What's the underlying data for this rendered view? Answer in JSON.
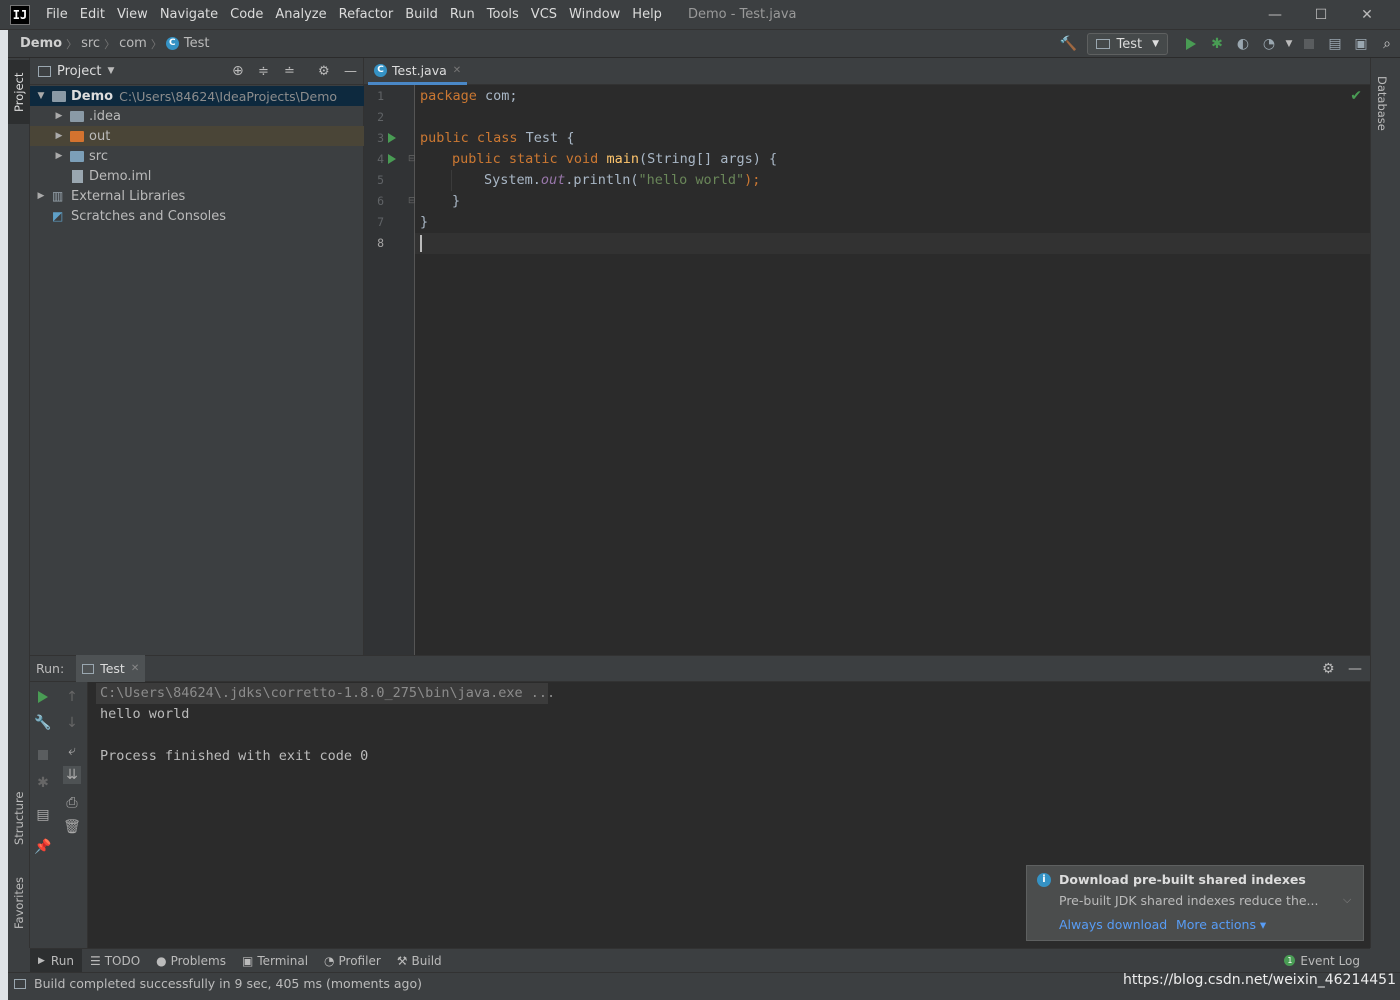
{
  "titlebar": {
    "logo": "IJ",
    "menu": [
      "File",
      "Edit",
      "View",
      "Navigate",
      "Code",
      "Analyze",
      "Refactor",
      "Build",
      "Run",
      "Tools",
      "VCS",
      "Window",
      "Help"
    ],
    "window_title": "Demo - Test.java",
    "controls": {
      "minimize": "—",
      "maximize": "☐",
      "close": "✕"
    }
  },
  "breadcrumb": {
    "project": "Demo",
    "items": [
      "src",
      "com",
      "Test"
    ]
  },
  "toolbar": {
    "run_config": "Test"
  },
  "left_stripe": {
    "project_tab": "Project",
    "structure_tab": "Structure",
    "favorites_tab": "Favorites"
  },
  "right_stripe": {
    "database_tab": "Database"
  },
  "project_panel": {
    "title": "Project",
    "tree": {
      "root_name": "Demo",
      "root_path": "C:\\Users\\84624\\IdeaProjects\\Demo",
      "idea": ".idea",
      "out": "out",
      "src": "src",
      "iml": "Demo.iml",
      "ext_libs": "External Libraries",
      "scratches": "Scratches and Consoles"
    }
  },
  "editor": {
    "tab_label": "Test.java",
    "line_numbers": [
      "1",
      "2",
      "3",
      "4",
      "5",
      "6",
      "7",
      "8"
    ],
    "code": {
      "l1_kw": "package",
      "l1_rest": " com;",
      "l3_kw": "public class",
      "l3_rest": " Test {",
      "l4_kw": "public static void",
      "l4_fn": "main",
      "l4_rest": "(String[] args) {",
      "l5_a": "System.",
      "l5_fld": "out",
      "l5_b": ".println(",
      "l5_str": "\"hello world\"",
      "l5_c": ");",
      "l6": "}",
      "l7": "}"
    }
  },
  "run_panel": {
    "label": "Run:",
    "tab": "Test",
    "console": [
      "C:\\Users\\84624\\.jdks\\corretto-1.8.0_275\\bin\\java.exe ...",
      "hello world",
      "",
      "Process finished with exit code 0"
    ]
  },
  "bottom_tools": [
    "Run",
    "TODO",
    "Problems",
    "Terminal",
    "Profiler",
    "Build"
  ],
  "event_log": "Event Log",
  "status": "Build completed successfully in 9 sec, 405 ms (moments ago)",
  "notification": {
    "title": "Download pre-built shared indexes",
    "body": "Pre-built JDK shared indexes reduce the...",
    "action1": "Always download",
    "action2": "More actions ▾"
  },
  "watermark": "https://blog.csdn.net/weixin_46214451",
  "colors": {
    "accent": "#4a88c7",
    "run_green": "#499c54",
    "keyword": "#cc7832",
    "string": "#6a8759"
  }
}
